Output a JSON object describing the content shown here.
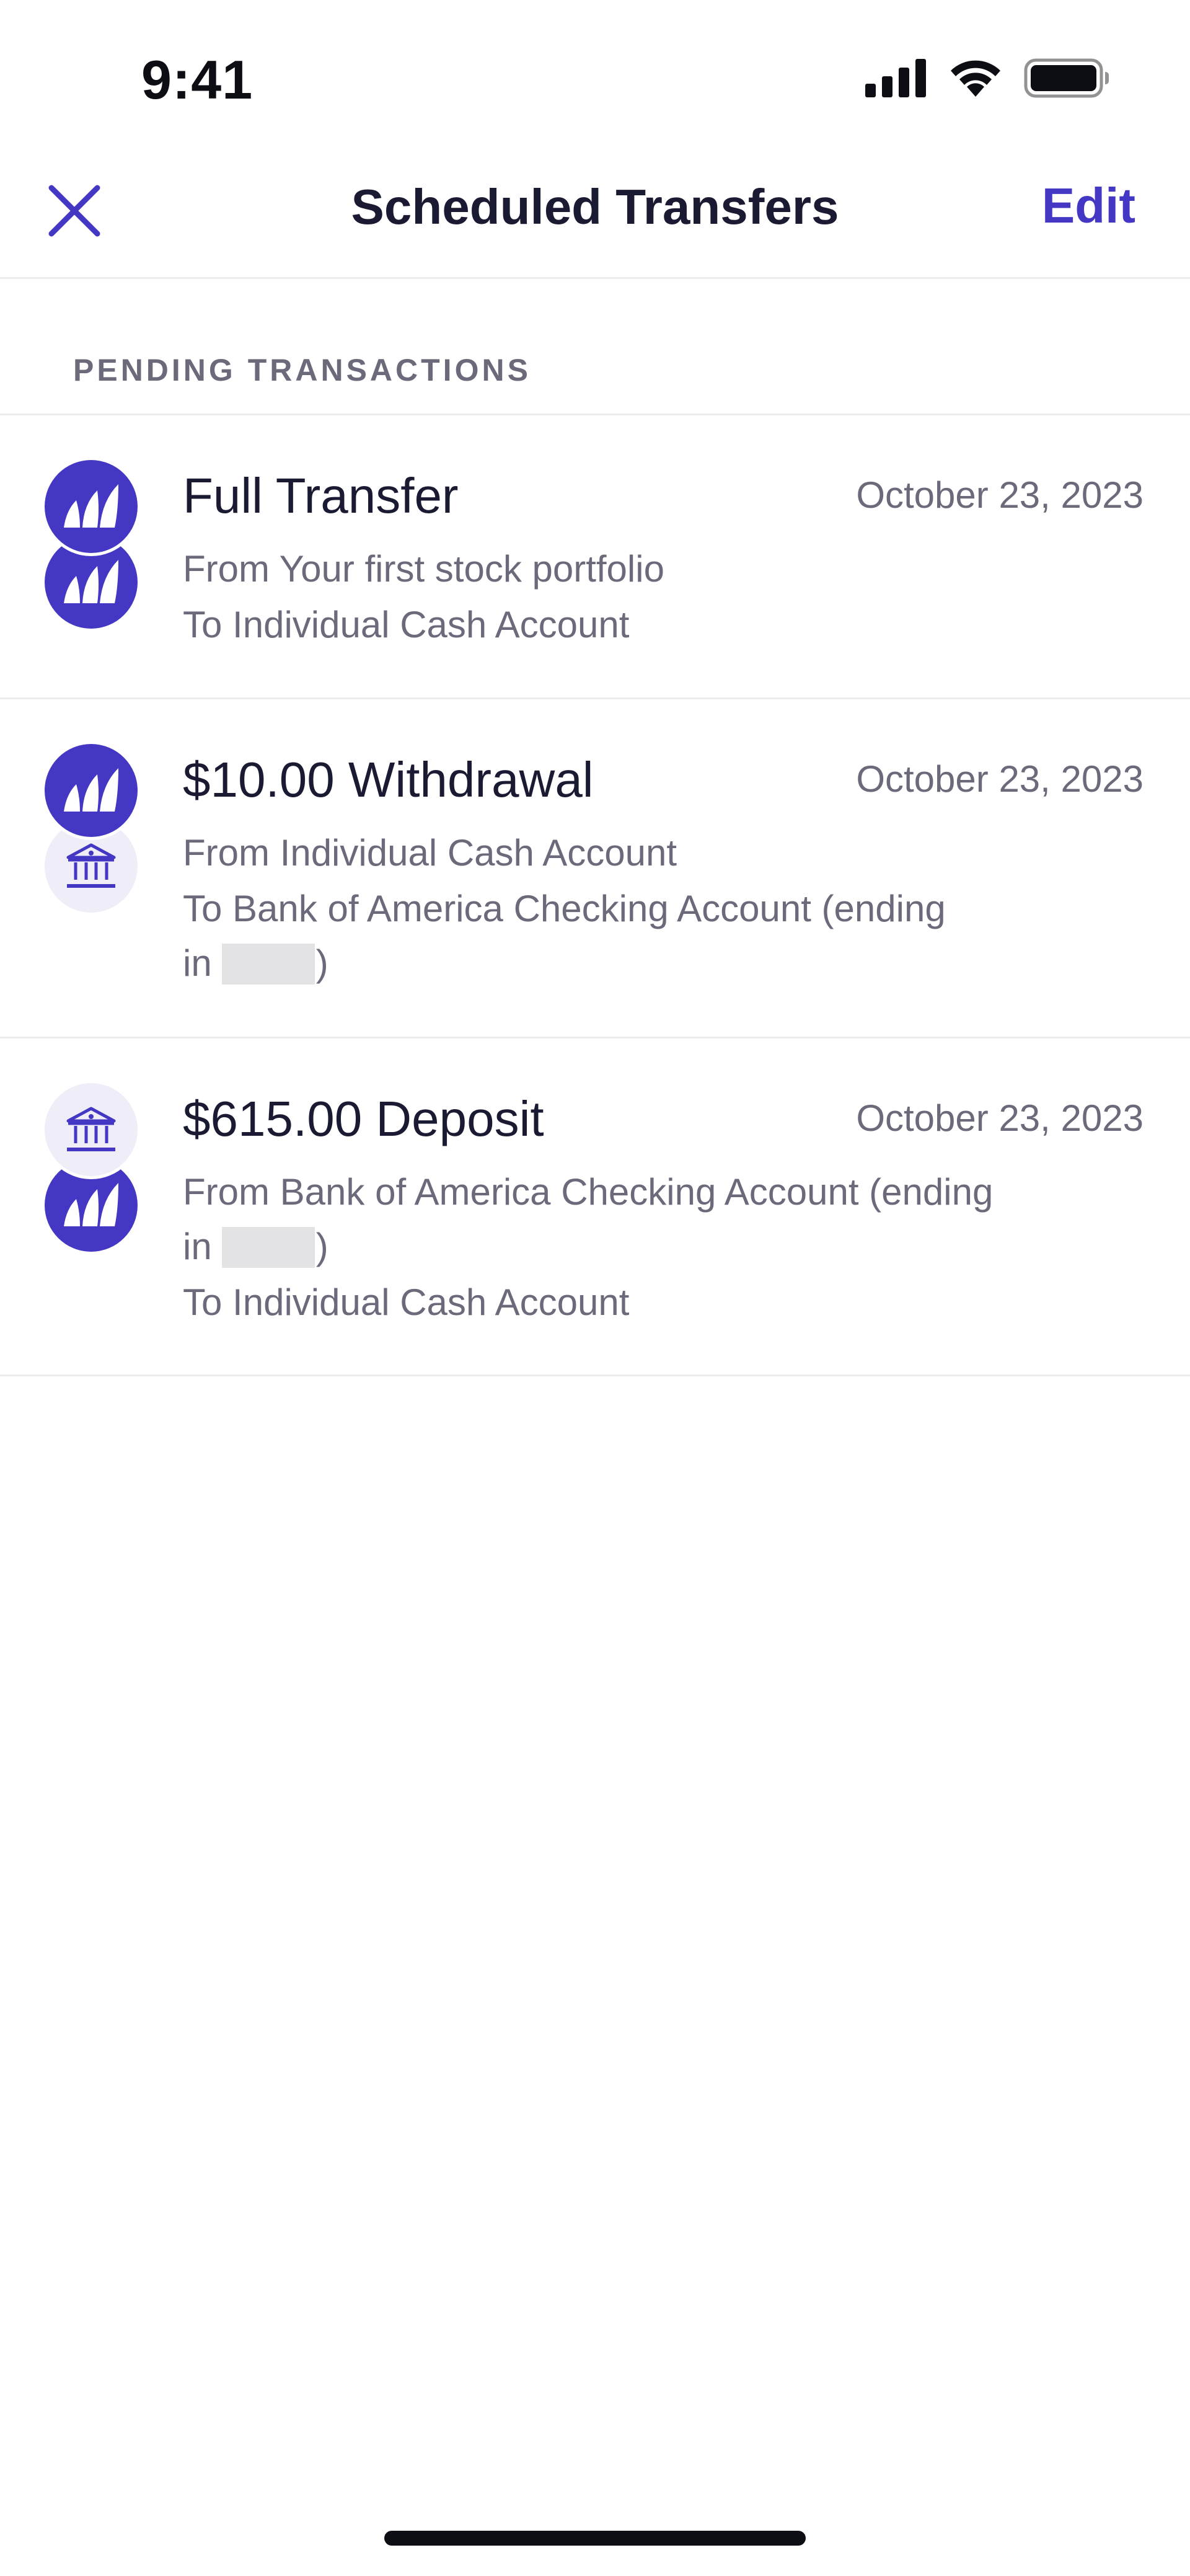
{
  "status_bar": {
    "time": "9:41",
    "icons": [
      "signal-icon",
      "wifi-icon",
      "battery-icon"
    ]
  },
  "nav": {
    "close_icon": "close-icon",
    "title": "Scheduled Transfers",
    "edit_label": "Edit"
  },
  "section": {
    "title": "PENDING TRANSACTIONS"
  },
  "transactions": [
    {
      "title": "Full Transfer",
      "date": "October 23, 2023",
      "from": "From Your first stock portfolio",
      "to": "To Individual Cash Account",
      "icons": [
        "brand-logo-icon",
        "brand-logo-icon"
      ]
    },
    {
      "title": "$10.00 Withdrawal",
      "date": "October 23, 2023",
      "from": "From Individual Cash Account",
      "to": "To Bank of America Checking Account (ending",
      "to_cont_prefix": "in",
      "to_cont_suffix": ")",
      "icons": [
        "brand-logo-icon",
        "bank-icon"
      ]
    },
    {
      "title": "$615.00 Deposit",
      "date": "October 23, 2023",
      "from": "From Bank of America Checking Account (ending",
      "from_cont_prefix": "in",
      "from_cont_suffix": ")",
      "to": "To Individual Cash Account",
      "icons": [
        "bank-icon",
        "brand-logo-icon"
      ]
    }
  ],
  "colors": {
    "accent": "#4437c4",
    "text_primary": "#1b1a33",
    "text_secondary": "#6b6a7a",
    "divider": "#ececef",
    "bank_icon_bg": "#eeedf8"
  }
}
